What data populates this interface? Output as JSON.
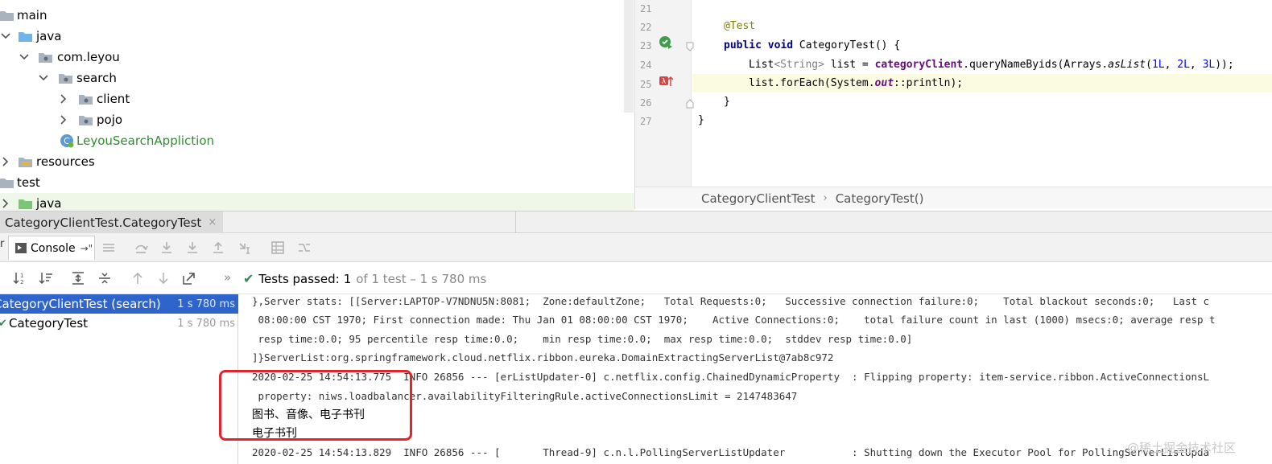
{
  "project_tree": {
    "items": [
      {
        "label": "main",
        "icon": "folder-icon"
      },
      {
        "label": "java",
        "icon": "source-folder-icon"
      },
      {
        "label": "com.leyou",
        "icon": "package-icon"
      },
      {
        "label": "search",
        "icon": "package-icon"
      },
      {
        "label": "client",
        "icon": "package-icon"
      },
      {
        "label": "pojo",
        "icon": "package-icon"
      },
      {
        "label": "LeyouSearchAppliction",
        "icon": "spring-class-icon"
      },
      {
        "label": "resources",
        "icon": "resources-folder-icon"
      },
      {
        "label": "test",
        "icon": "folder-icon"
      },
      {
        "label": "java",
        "icon": "test-source-folder-icon"
      }
    ]
  },
  "editor": {
    "line_numbers": [
      "21",
      "22",
      "23",
      "24",
      "25",
      "26",
      "27"
    ],
    "code": {
      "l22": "@Test",
      "l23_kw": "public void",
      "l23_rest": " CategoryTest() {",
      "l24_a": "List",
      "l24_b": "<String>",
      "l24_c": " list = ",
      "l24_d": "categoryClient",
      "l24_e": ".queryNameByids(Arrays.",
      "l24_f": "asList",
      "l24_g": "(",
      "l24_n1": "1L",
      "l24_s1": ", ",
      "l24_n2": "2L",
      "l24_s2": ", ",
      "l24_n3": "3L",
      "l24_h": "));",
      "l25_a": "list.forEach(System.",
      "l25_b": "out",
      "l25_c": "::println);",
      "l26": "}",
      "l27": "}"
    }
  },
  "breadcrumb": {
    "class_name": "CategoryClientTest",
    "separator": "›",
    "method_name": "CategoryTest()"
  },
  "run_tab": {
    "label": "CategoryClientTest.CategoryTest",
    "close": "×"
  },
  "console_toolbar": {
    "left_edge": "r",
    "console_label": "Console",
    "console_suffix": "→\""
  },
  "test_toolbar": {
    "more": "»",
    "status_check": "✔",
    "status_label": "Tests passed:",
    "status_count": "1",
    "status_detail": "of 1 test – 1 s 780 ms"
  },
  "test_tree": [
    {
      "label": "CategoryClientTest (search)",
      "time": "1 s 780 ms",
      "selected": true
    },
    {
      "label": "CategoryTest",
      "time": "1 s 780 ms",
      "selected": false
    }
  ],
  "console_output": [
    "},Server stats: [[Server:LAPTOP-V7NDNU5N:8081;  Zone:defaultZone;   Total Requests:0;   Successive connection failure:0;    Total blackout seconds:0;   Last c",
    " 08:00:00 CST 1970; First connection made: Thu Jan 01 08:00:00 CST 1970;    Active Connections:0;    total failure count in last (1000) msecs:0; average resp t",
    " resp time:0.0; 95 percentile resp time:0.0;    min resp time:0.0;  max resp time:0.0;  stddev resp time:0.0]",
    "]}ServerList:org.springframework.cloud.netflix.ribbon.eureka.DomainExtractingServerList@7ab8c972",
    "2020-02-25 14:54:13.775  INFO 26856 --- [erListUpdater-0] c.netflix.config.ChainedDynamicProperty  : Flipping property: item-service.ribbon.ActiveConnectionsL",
    " property: niws.loadbalancer.availabilityFilteringRule.activeConnectionsLimit = 2147483647",
    "图书、音像、电子书刊",
    "电子书刊",
    "2020-02-25 14:54:13.829  INFO 26856 --- [       Thread-9] c.n.l.PollingServerListUpdater           : Shutting down the Executor Pool for PollingServerListUpda"
  ],
  "watermark": "@稀土掘金技术社区",
  "colors": {
    "selection": "#2f65ca",
    "highlight_box": "#e3242b",
    "passed": "#2e8b57"
  }
}
